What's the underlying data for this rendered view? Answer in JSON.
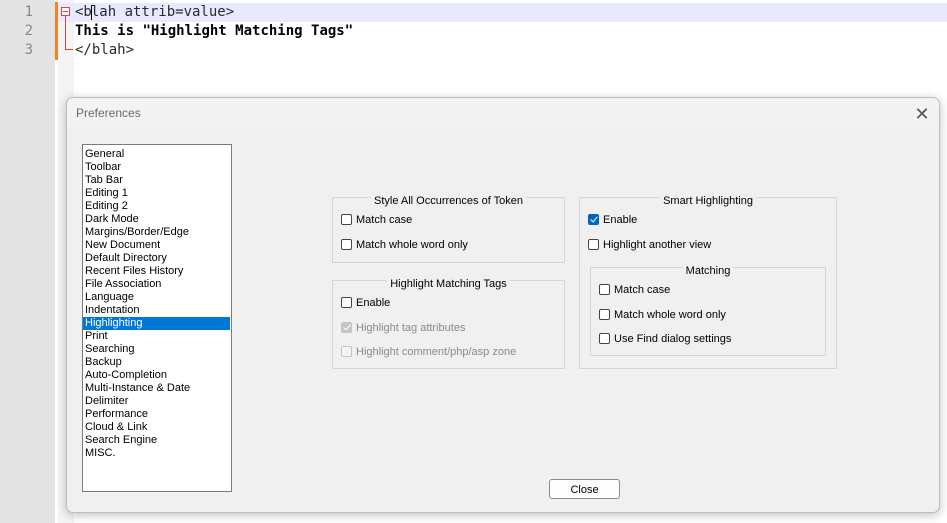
{
  "editor": {
    "line_numbers": [
      "1",
      "2",
      "3"
    ],
    "line1_tag": "<b",
    "line1_rest": "lah attrib=value>",
    "line2_prefix": "This is ",
    "line2_string": "\"Highlight Matching Tags\"",
    "line3": "</blah>"
  },
  "dialog": {
    "title": "Preferences",
    "close_glyph": "✕",
    "categories": [
      "General",
      "Toolbar",
      "Tab Bar",
      "Editing 1",
      "Editing 2",
      "Dark Mode",
      "Margins/Border/Edge",
      "New Document",
      "Default Directory",
      "Recent Files History",
      "File Association",
      "Language",
      "Indentation",
      "Highlighting",
      "Print",
      "Searching",
      "Backup",
      "Auto-Completion",
      "Multi-Instance & Date",
      "Delimiter",
      "Performance",
      "Cloud & Link",
      "Search Engine",
      "MISC."
    ],
    "selected_category": "Highlighting",
    "style_all": {
      "title": "Style All Occurrences of Token",
      "match_case": "Match case",
      "match_whole_word": "Match whole word only"
    },
    "matching_tags": {
      "title": "Highlight Matching Tags",
      "enable": "Enable",
      "tag_attributes": "Highlight tag attributes",
      "comment_zone": "Highlight comment/php/asp zone"
    },
    "smart": {
      "title": "Smart Highlighting",
      "enable": "Enable",
      "another_view": "Highlight another view",
      "matching_title": "Matching",
      "match_case": "Match case",
      "match_whole_word": "Match whole word only",
      "use_find": "Use Find dialog settings"
    },
    "checkbox_state": {
      "style_all_match_case": false,
      "style_all_whole_word": false,
      "tags_enable": false,
      "tags_attributes": true,
      "tags_comment_zone": false,
      "smart_enable": true,
      "smart_another_view": false,
      "smart_match_case": false,
      "smart_whole_word": false,
      "smart_use_find": false
    },
    "close_button": "Close"
  },
  "colors": {
    "accent": "#0078d7",
    "change_bar": "#f58220",
    "fold_marker": "#e0413a"
  }
}
